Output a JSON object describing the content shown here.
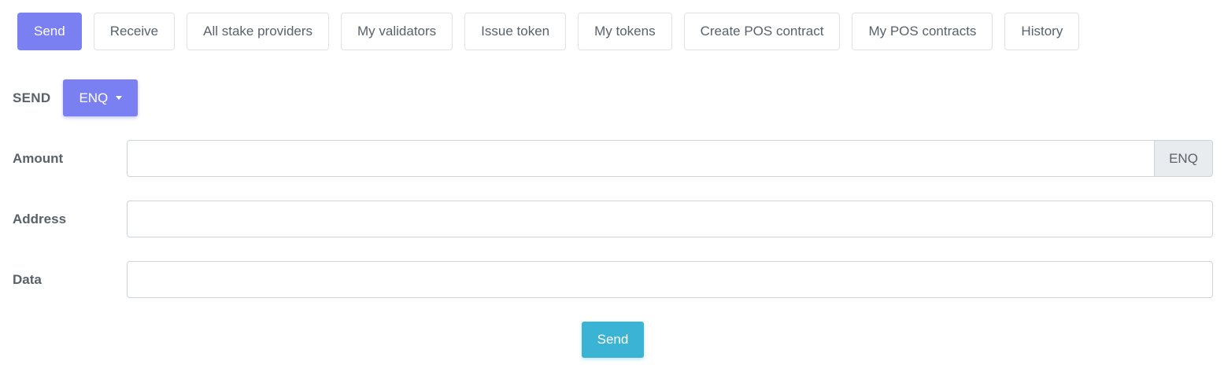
{
  "tabs": [
    {
      "label": "Send",
      "active": true
    },
    {
      "label": "Receive",
      "active": false
    },
    {
      "label": "All stake providers",
      "active": false
    },
    {
      "label": "My validators",
      "active": false
    },
    {
      "label": "Issue token",
      "active": false
    },
    {
      "label": "My tokens",
      "active": false
    },
    {
      "label": "Create POS contract",
      "active": false
    },
    {
      "label": "My POS contracts",
      "active": false
    },
    {
      "label": "History",
      "active": false
    }
  ],
  "send_form": {
    "title": "SEND",
    "token_selector": {
      "selected": "ENQ"
    },
    "fields": {
      "amount": {
        "label": "Amount",
        "value": "",
        "placeholder": "",
        "unit": "ENQ"
      },
      "address": {
        "label": "Address",
        "value": "",
        "placeholder": ""
      },
      "data": {
        "label": "Data",
        "value": "",
        "placeholder": ""
      }
    },
    "submit_label": "Send"
  },
  "colors": {
    "primary": "#7a7ff2",
    "info": "#3bb3d4",
    "addon_bg": "#e9ecef",
    "border": "#dee2e6",
    "text": "#5a6169"
  }
}
